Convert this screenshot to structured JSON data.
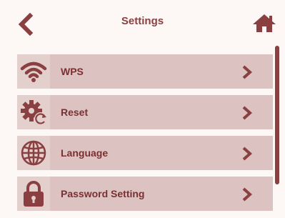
{
  "header": {
    "title": "Settings",
    "back_icon": "chevron-left-icon",
    "home_icon": "home-icon"
  },
  "menu": {
    "items": [
      {
        "label": "WPS",
        "icon": "wifi-icon"
      },
      {
        "label": "Reset",
        "icon": "gear-reset-icon"
      },
      {
        "label": "Language",
        "icon": "globe-icon"
      },
      {
        "label": "Password Setting",
        "icon": "lock-icon"
      }
    ]
  },
  "colors": {
    "accent": "#8a3f40",
    "item_bg": "#dcc3c1",
    "background": "#fdf7f6"
  }
}
